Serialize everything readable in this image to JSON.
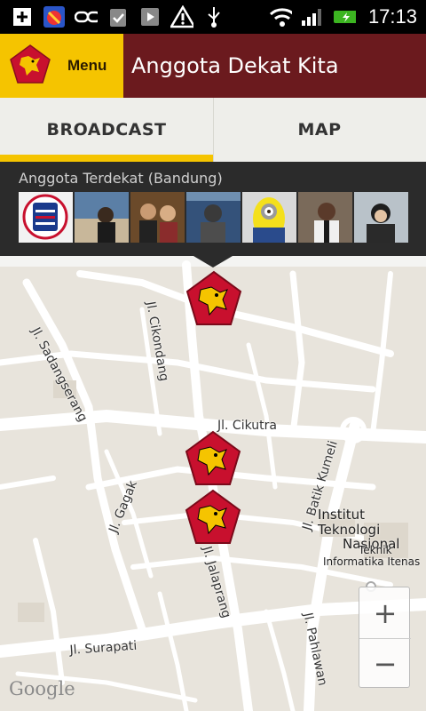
{
  "status_bar": {
    "time": "17:13",
    "icons": [
      "add-icon",
      "candy-game-icon",
      "link-icon",
      "clipboard-check-icon",
      "media-play-icon",
      "warning-icon",
      "usb-icon",
      "wifi-icon",
      "signal-icon",
      "battery-charging-icon"
    ]
  },
  "header": {
    "menu_label": "Menu",
    "title": "Anggota Dekat Kita"
  },
  "tabs": [
    {
      "label": "BROADCAST",
      "active": true
    },
    {
      "label": "MAP",
      "active": false
    }
  ],
  "nearby": {
    "title": "Anggota Terdekat (Bandung)",
    "avatars": [
      "persija-logo",
      "person-photo-1",
      "couple-photo",
      "person-photo-3",
      "minion-photo",
      "person-photo-5",
      "person-photo-6"
    ]
  },
  "map": {
    "roads": [
      "Jl. Cikondang",
      "Jl. Sadangserang",
      "Jl. Cikutra",
      "Jl. Gagak",
      "Jl. Batik Kumeli",
      "Jl. Jalaprang",
      "Jl. Surapati",
      "Jl. Pahlawan"
    ],
    "pois": {
      "institut": [
        "Institut Teknologi",
        "Nasional"
      ],
      "teknik": [
        "Teknik",
        "Informatika Itenas"
      ]
    },
    "attribution": "Google",
    "zoom_in": "+",
    "zoom_out": "−"
  },
  "colors": {
    "accent_yellow": "#f5c400",
    "brand_maroon": "#6b1a1e",
    "marker_red": "#c8102e"
  }
}
